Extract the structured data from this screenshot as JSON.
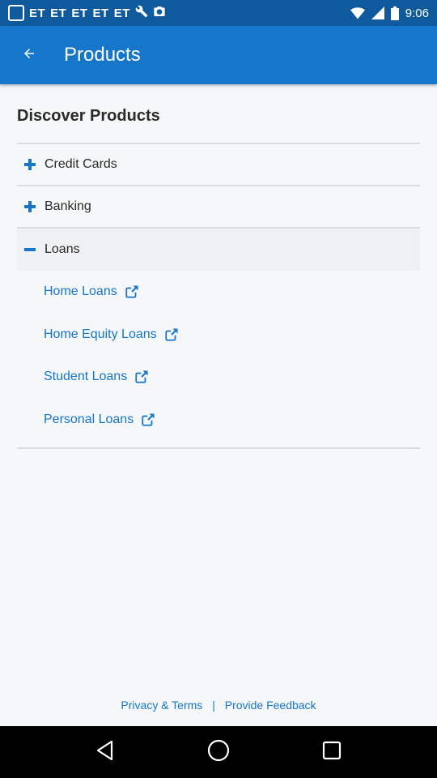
{
  "status_bar": {
    "carrier_labels": [
      "ET",
      "ET",
      "ET",
      "ET",
      "ET"
    ],
    "time": "9:06"
  },
  "app_bar": {
    "title": "Products",
    "back_icon": "arrow-back-icon"
  },
  "section_title": "Discover Products",
  "categories": [
    {
      "label": "Credit Cards",
      "icon": "plus-icon",
      "expanded": false
    },
    {
      "label": "Banking",
      "icon": "plus-icon",
      "expanded": false
    },
    {
      "label": "Loans",
      "icon": "minus-icon",
      "expanded": true
    }
  ],
  "loans_items": [
    {
      "label": "Home Loans",
      "icon": "external-link-icon"
    },
    {
      "label": "Home Equity Loans",
      "icon": "external-link-icon"
    },
    {
      "label": "Student Loans",
      "icon": "external-link-icon"
    },
    {
      "label": "Personal Loans",
      "icon": "external-link-icon"
    }
  ],
  "footer": {
    "privacy_label": "Privacy & Terms",
    "separator": "|",
    "feedback_label": "Provide Feedback"
  },
  "colors": {
    "primary": "#1676c9",
    "status_bar": "#0e5a9c",
    "background": "#f5f7f8"
  }
}
